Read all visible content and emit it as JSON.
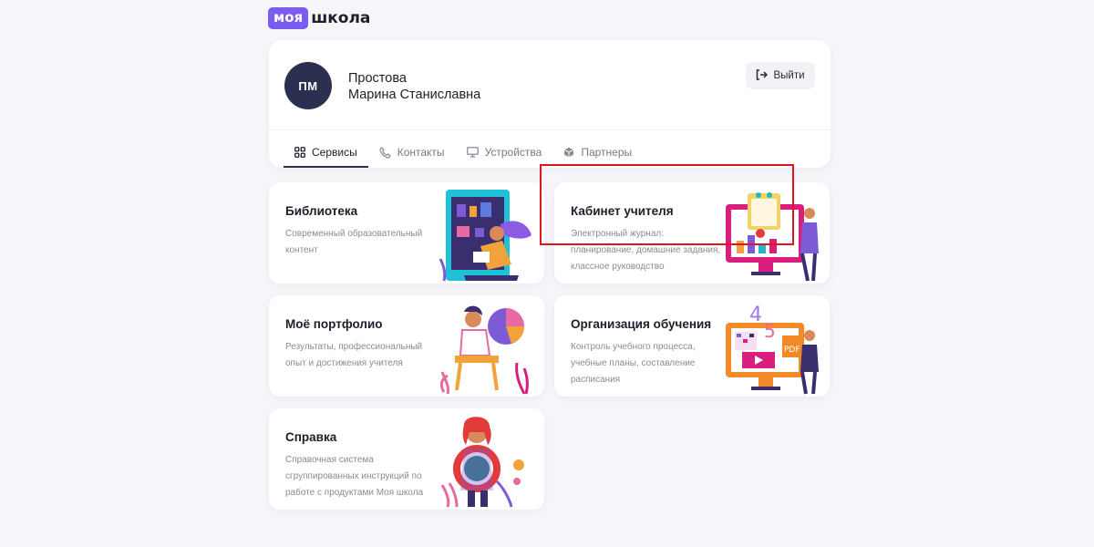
{
  "logo": {
    "part1": "моя",
    "part2": "школа"
  },
  "profile": {
    "initials": "ПМ",
    "last_name": "Простова",
    "first_names": "Марина Станиславна",
    "logout_label": "Выйти"
  },
  "tabs": [
    {
      "label": "Сервисы",
      "icon": "grid-icon",
      "active": true
    },
    {
      "label": "Контакты",
      "icon": "phone-icon",
      "active": false
    },
    {
      "label": "Устройства",
      "icon": "monitor-icon",
      "active": false
    },
    {
      "label": "Партнеры",
      "icon": "cube-icon",
      "active": false
    }
  ],
  "cards": [
    {
      "title": "Библиотека",
      "description": "Современный образовательный контент",
      "illustration": "library-illustration"
    },
    {
      "title": "Кабинет учителя",
      "description": "Электронный журнал: планирование, домашние задания, классное руководство",
      "illustration": "teacher-office-illustration"
    },
    {
      "title": "Моё портфолио",
      "description": "Результаты, профессиональный опыт и достижения учителя",
      "illustration": "portfolio-illustration"
    },
    {
      "title": "Организация обучения",
      "description": "Контроль учебного процесса, учебные планы, составление расписания",
      "illustration": "learning-organization-illustration"
    },
    {
      "title": "Справка",
      "description": "Справочная система сгруппированных инструкций по работе с продуктами Моя школа",
      "illustration": "help-illustration"
    }
  ],
  "colors": {
    "brand": "#7a5cf0",
    "avatar_bg": "#2b3050",
    "highlight": "#e0151d",
    "page_bg": "#f6f6fa"
  }
}
